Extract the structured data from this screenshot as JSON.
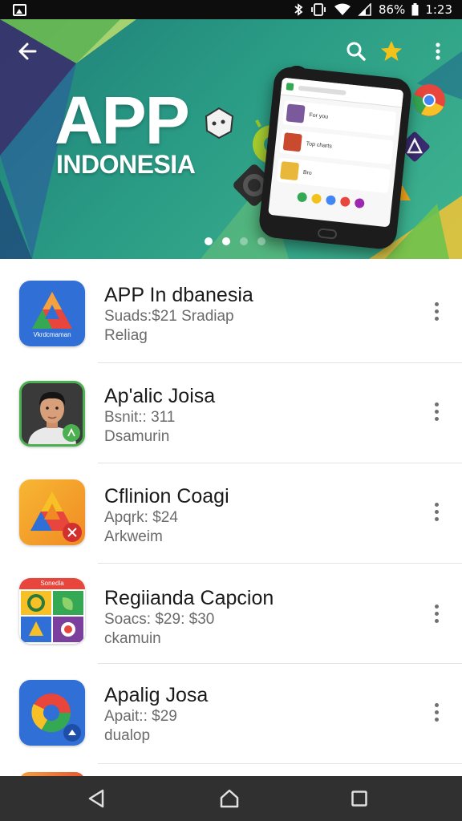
{
  "status_bar": {
    "battery_percent": "86%",
    "time": "1:23",
    "icons": [
      "gallery-icon",
      "bluetooth-icon",
      "vibrate-icon",
      "wifi-icon",
      "signal-icon",
      "battery-icon"
    ]
  },
  "banner": {
    "title": "APP",
    "subtitle": "INDONESIA",
    "carousel": {
      "page_count": 4,
      "active_index": 1
    },
    "phone_screen": {
      "rows": [
        "For you",
        "Top charts",
        "Bro"
      ]
    },
    "colors": {
      "background": "#2a9c85",
      "accent_yellow": "#f2c21b"
    }
  },
  "top_actions": {
    "icons": [
      "back-arrow-icon",
      "search-icon",
      "star-icon",
      "more-vert-icon"
    ]
  },
  "apps": [
    {
      "name": "APP In dbanesia",
      "line1": "Suads:$21 Sradiap",
      "line2": "Reliag",
      "icon": "delta-logo-icon",
      "icon_label": "Vkrdcmaman"
    },
    {
      "name": "Ap'alic Joisa",
      "line1": "Bsnit:: 311",
      "line2": "Dsamurin",
      "icon": "person-photo-icon"
    },
    {
      "name": "Cflinion Coagi",
      "line1": "Apqrk: $24",
      "line2": "Arkweim",
      "icon": "delta-orange-icon"
    },
    {
      "name": "Regiianda Capcion",
      "line1": "Soacs: $29: $30",
      "line2": "ckamuin",
      "icon": "grid-tiles-icon",
      "icon_label": "Sonedla"
    },
    {
      "name": "Apalig Josa",
      "line1": "Apait:: $29",
      "line2": "dualop",
      "icon": "ring-logo-icon"
    }
  ],
  "nav_bar": {
    "icons": [
      "back-triangle-icon",
      "home-icon",
      "recents-square-icon"
    ]
  }
}
